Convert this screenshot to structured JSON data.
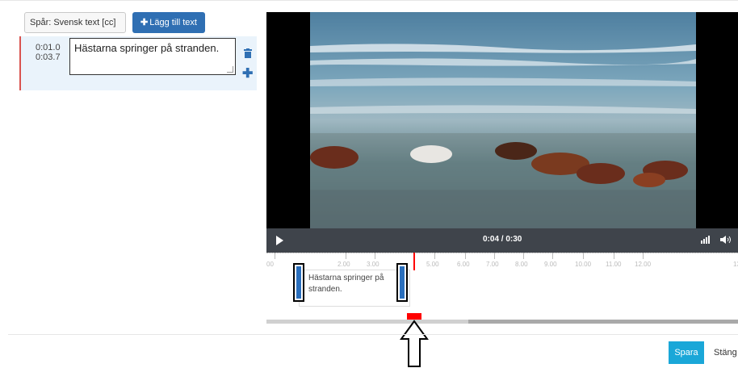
{
  "left_panel": {
    "track_label": "Spår: Svensk text [cc] *",
    "add_text_label": "Lägg till text",
    "caption": {
      "start": "0:01.0",
      "end": "0:03.7",
      "text": "Hästarna springer på stranden."
    }
  },
  "player": {
    "time": "0:04 / 0:30"
  },
  "timeline": {
    "ticks": [
      "00",
      "2.00",
      "3.00",
      "5.00",
      "6.00",
      "7.00",
      "8.00",
      "9.00",
      "10.00",
      "11.00",
      "12.00",
      "13"
    ],
    "caption_block_text": "Hästarna springer på stranden."
  },
  "footer": {
    "save_label": "Spara",
    "close_label": "Stäng"
  },
  "colors": {
    "primary": "#2f6fb3",
    "save": "#1aa7d8",
    "playhead": "#ff0000"
  }
}
